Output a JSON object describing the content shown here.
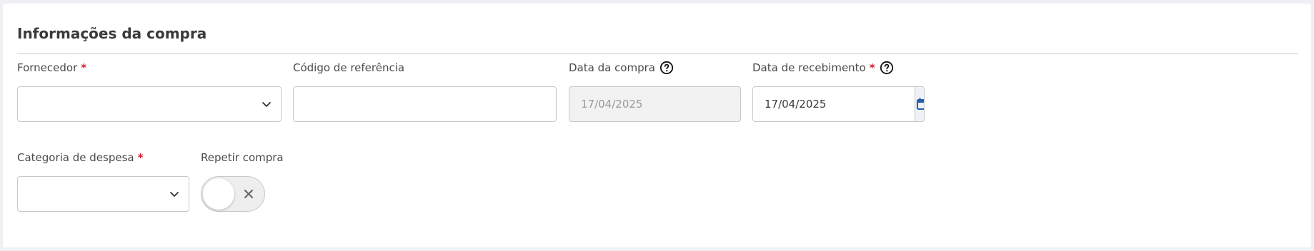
{
  "section": {
    "title": "Informações da compra"
  },
  "fields": {
    "fornecedor": {
      "label": "Fornecedor",
      "required_mark": "*",
      "value": ""
    },
    "codigo_referencia": {
      "label": "Código de referência",
      "value": ""
    },
    "data_compra": {
      "label": "Data da compra",
      "value": "17/04/2025",
      "help_icon": "question-circle-icon"
    },
    "data_recebimento": {
      "label": "Data de recebimento",
      "required_mark": "*",
      "value": "17/04/2025",
      "help_icon": "question-circle-icon",
      "calendar_icon": "calendar-icon"
    },
    "categoria_despesa": {
      "label": "Categoria de despesa",
      "required_mark": "*",
      "value": ""
    },
    "repetir_compra": {
      "label": "Repetir compra",
      "state": "off"
    }
  },
  "colors": {
    "required": "#d0202e",
    "calendar_icon": "#1f5fae",
    "disabled_bg": "#f2f2f2"
  }
}
